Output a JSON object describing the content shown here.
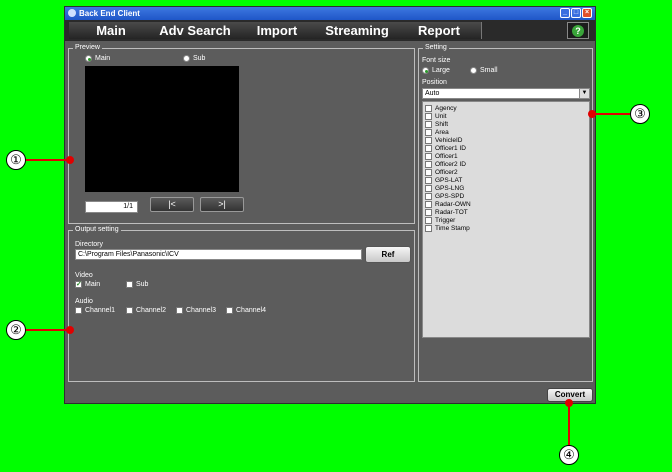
{
  "window": {
    "title": "Back End Client",
    "minimize": "_",
    "maximize": "□",
    "close": "×"
  },
  "menu": {
    "tabs": [
      "Main",
      "Adv Search",
      "Import",
      "Streaming",
      "Report"
    ],
    "help": "?"
  },
  "preview": {
    "legend": "Preview",
    "radio_main": "Main",
    "radio_sub": "Sub",
    "counter": "1/1",
    "prev_label": "|<",
    "next_label": ">|"
  },
  "output": {
    "legend": "Output setting",
    "directory_label": "Directory",
    "directory_value": "C:\\Program Files\\Panasonic\\ICV",
    "ref_label": "Ref",
    "video_label": "Video",
    "video_main": "Main",
    "video_sub": "Sub",
    "audio_label": "Audio",
    "channels": [
      "Channel1",
      "Channel2",
      "Channel3",
      "Channel4"
    ]
  },
  "setting": {
    "legend": "Setting",
    "font_size_label": "Font size",
    "font_large": "Large",
    "font_small": "Small",
    "position_label": "Position",
    "position_value": "Auto",
    "items": [
      "Agency",
      "Unit",
      "Shift",
      "Area",
      "VehicleID",
      "Officer1 ID",
      "Officer1",
      "Officer2 ID",
      "Officer2",
      "GPS-LAT",
      "GPS-LNG",
      "GPS-SPD",
      "Radar-OWN",
      "Radar-TOT",
      "Trigger",
      "Time Stamp"
    ]
  },
  "convert_label": "Convert",
  "callouts": [
    "①",
    "②",
    "③",
    "④"
  ],
  "colors": {
    "background": "#00ff00",
    "leader": "#e00000",
    "window": "#5c5c5c"
  }
}
